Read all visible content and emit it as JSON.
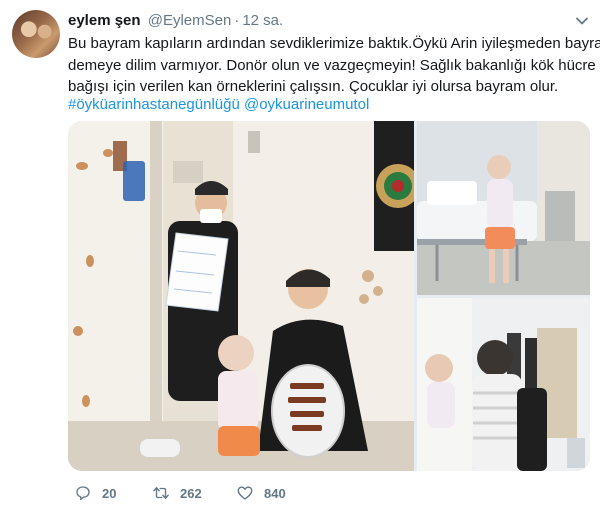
{
  "tweet": {
    "author_name": "eylem şen",
    "author_handle": "@EylemSen",
    "separator": "·",
    "time_ago": "12 sa.",
    "text_lines": [
      "Bu bayram kapıların ardından sevdiklerimize baktık.Öykü Arin iyileşmeden bayram",
      "demeye dilim varmıyor. Donör olun ve vazgeçmeyin! Sağlık bakanlığı kök hücre",
      "bağışı için verilen kan örneklerini çalışsın. Çocuklar iyi olursa bayram olur."
    ],
    "hashtag": "#öyküarinhastanegünlüğü",
    "mention": "@oykuarineumutol"
  },
  "actions": {
    "reply_count": "20",
    "retweet_count": "262",
    "like_count": "840"
  },
  "icons": {
    "menu": "chevron-down-icon",
    "reply": "reply-icon",
    "retweet": "retweet-icon",
    "like": "heart-icon"
  },
  "colors": {
    "link": "#1b95e0",
    "secondary_text": "#657786",
    "primary_text": "#14171a"
  }
}
